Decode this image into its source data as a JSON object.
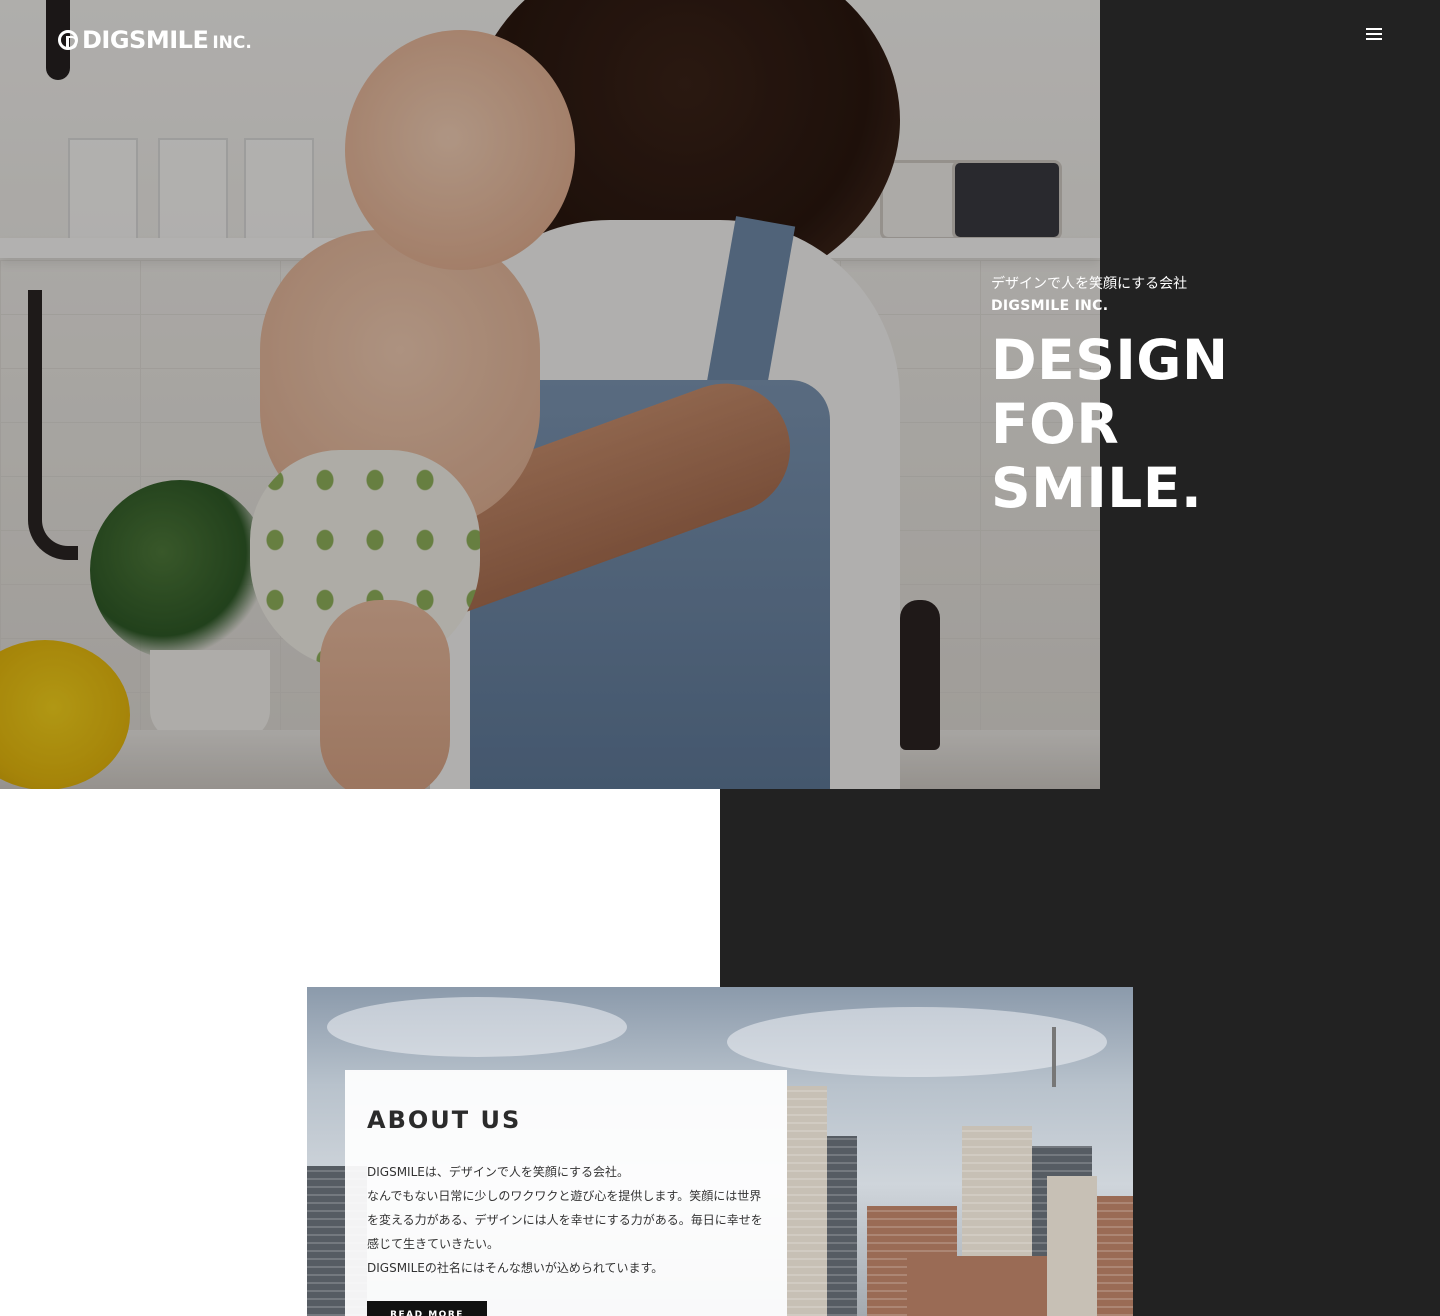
{
  "header": {
    "logo_name": "DIGSMILE",
    "logo_suffix": "INC."
  },
  "hero": {
    "tagline": "デザインで人を笑顔にする会社",
    "company": "DIGSMILE INC.",
    "headline": [
      "DESIGN",
      "FOR",
      "SMILE."
    ]
  },
  "about": {
    "title": "ABOUT US",
    "paragraphs": [
      "DIGSMILEは、デザインで人を笑顔にする会社。",
      "なんでもない日常に少しのワクワクと遊び心を提供します。笑顔には世界",
      "を変える力がある、デザインには人を幸せにする力がある。毎日に幸せを",
      "感じて生きていきたい。",
      "DIGSMILEの社名にはそんな想いが込められています。"
    ],
    "button_label": "READ MORE"
  },
  "colors": {
    "dark_panel": "#222222",
    "text_light": "#ffffff",
    "button": "#111111"
  },
  "icons": {
    "menu": "hamburger-menu-icon",
    "logo": "digsmile-logo-mark"
  }
}
